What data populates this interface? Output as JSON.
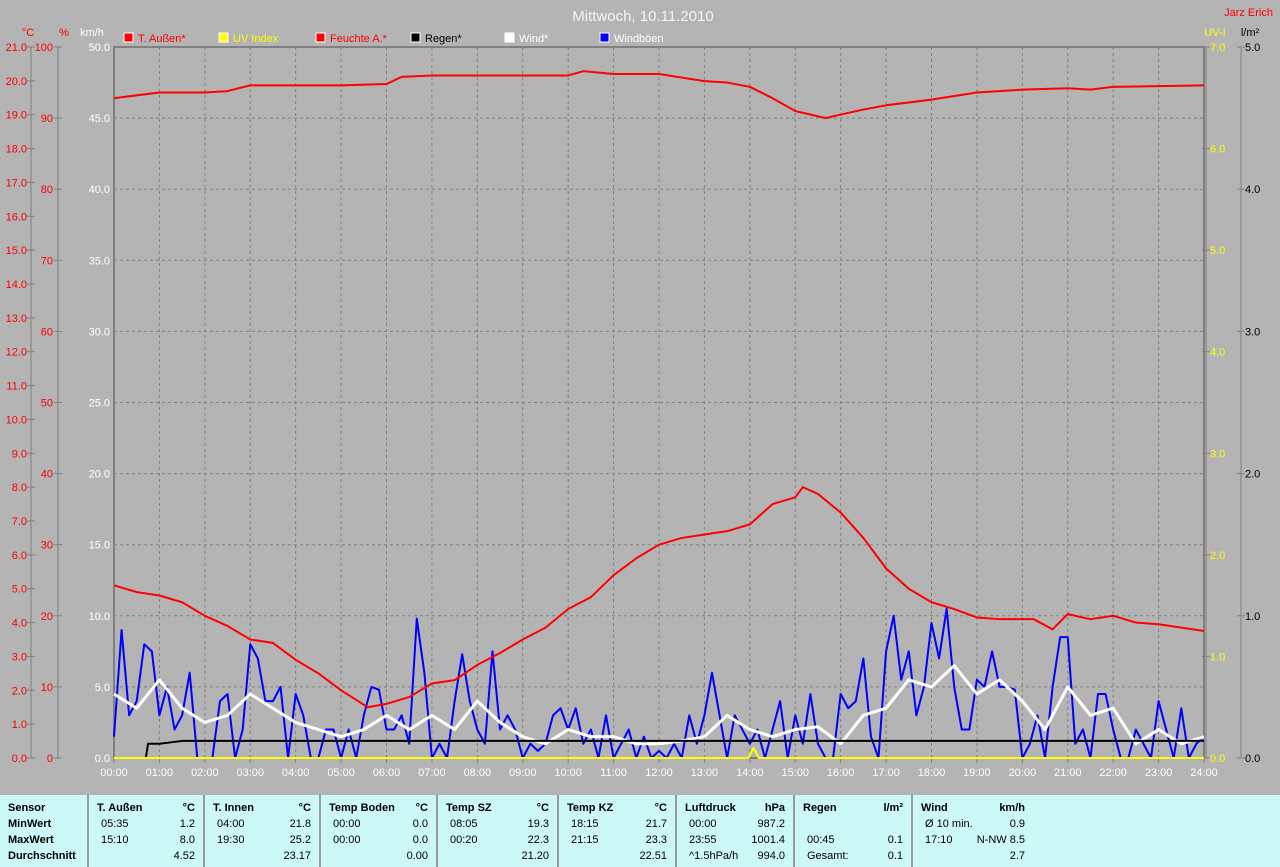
{
  "header": {
    "title": "Mittwoch, 10.11.2010",
    "author": "Jarz Erich"
  },
  "legend": [
    {
      "label": "T. Außen*",
      "color": "#ff0000",
      "text_color": "#ff0000"
    },
    {
      "label": "UV Index",
      "color": "#ffff00",
      "text_color": "#ffff00"
    },
    {
      "label": "Feuchte A.*",
      "color": "#ff0000",
      "text_color": "#ff0000"
    },
    {
      "label": "Regen*",
      "color": "#000000",
      "text_color": "#000000"
    },
    {
      "label": "Wind*",
      "color": "#ffffff",
      "text_color": "#ffffff"
    },
    {
      "label": "Windböen",
      "color": "#0000ff",
      "text_color": "#ffffff"
    }
  ],
  "chart_data": {
    "type": "line",
    "grid": true,
    "x_range": [
      "00:00",
      "24:00"
    ],
    "x_ticks": [
      "00:00",
      "01:00",
      "02:00",
      "03:00",
      "04:00",
      "05:00",
      "06:00",
      "07:00",
      "08:00",
      "09:00",
      "10:00",
      "11:00",
      "12:00",
      "13:00",
      "14:00",
      "15:00",
      "16:00",
      "17:00",
      "18:00",
      "19:00",
      "20:00",
      "21:00",
      "22:00",
      "23:00",
      "24:00"
    ],
    "axes": {
      "temp": {
        "unit": "°C",
        "min": 0,
        "max": 21,
        "step": 1,
        "decimals": 1,
        "color": "#ff0000"
      },
      "humidity": {
        "unit": "%",
        "min": 0,
        "max": 100,
        "step": 10,
        "decimals": 0,
        "color": "#ff0000"
      },
      "wind": {
        "unit": "km/h",
        "min": 0,
        "max": 50,
        "step": 5,
        "decimals": 1,
        "color": "#ffffff"
      },
      "uv": {
        "unit": "UV-I",
        "min": 0,
        "max": 7,
        "step": 1,
        "decimals": 1,
        "color": "#ffff00"
      },
      "rain": {
        "unit": "l/m²",
        "min": 0,
        "max": 5,
        "step": 1,
        "decimals": 1,
        "color": "#000000"
      }
    },
    "series": [
      {
        "name": "T. Außen*",
        "axis": "temp",
        "color": "#ff0000",
        "x": [
          "00:00",
          "00:30",
          "01:00",
          "01:30",
          "02:00",
          "02:30",
          "03:00",
          "03:30",
          "04:00",
          "04:30",
          "05:00",
          "05:35",
          "06:00",
          "06:30",
          "07:00",
          "07:30",
          "08:00",
          "08:30",
          "09:00",
          "09:30",
          "10:00",
          "10:30",
          "11:00",
          "11:30",
          "12:00",
          "12:30",
          "13:00",
          "13:30",
          "14:00",
          "14:30",
          "15:00",
          "15:10",
          "15:30",
          "16:00",
          "16:30",
          "17:00",
          "17:30",
          "18:00",
          "18:30",
          "19:00",
          "19:30",
          "20:00",
          "20:15",
          "20:40",
          "21:00",
          "21:30",
          "22:00",
          "22:30",
          "23:00",
          "23:30",
          "24:00"
        ],
        "y": [
          5.1,
          4.9,
          4.8,
          4.6,
          4.2,
          3.9,
          3.5,
          3.4,
          2.9,
          2.5,
          2.0,
          1.5,
          1.6,
          1.8,
          2.2,
          2.3,
          2.75,
          3.1,
          3.5,
          3.85,
          4.4,
          4.75,
          5.4,
          5.9,
          6.3,
          6.5,
          6.6,
          6.7,
          6.9,
          7.5,
          7.7,
          8.0,
          7.8,
          7.25,
          6.5,
          5.6,
          5.0,
          4.6,
          4.4,
          4.15,
          4.1,
          4.1,
          4.1,
          3.8,
          4.25,
          4.1,
          4.2,
          4.0,
          3.95,
          3.85,
          3.75
        ]
      },
      {
        "name": "Feuchte A.*",
        "axis": "humidity",
        "color": "#ff0000",
        "x": [
          "00:00",
          "01:00",
          "02:00",
          "02:30",
          "03:00",
          "04:00",
          "05:00",
          "06:00",
          "06:20",
          "07:00",
          "08:00",
          "09:00",
          "10:00",
          "10:20",
          "11:00",
          "12:00",
          "13:00",
          "13:30",
          "14:00",
          "14:30",
          "15:00",
          "15:40",
          "16:00",
          "16:30",
          "17:00",
          "18:00",
          "19:00",
          "20:00",
          "21:00",
          "21:30",
          "22:00",
          "23:00",
          "24:00"
        ],
        "y": [
          92.8,
          93.6,
          93.6,
          93.8,
          94.6,
          94.6,
          94.6,
          94.8,
          95.8,
          96.0,
          96.0,
          96.0,
          96.0,
          96.6,
          96.2,
          96.2,
          95.2,
          95.0,
          94.4,
          92.8,
          91.0,
          90.0,
          90.5,
          91.2,
          91.8,
          92.6,
          93.6,
          94.0,
          94.2,
          94.0,
          94.4,
          94.5,
          94.6
        ]
      },
      {
        "name": "UV Index",
        "axis": "uv",
        "color": "#ffff00",
        "x": [
          "00:00",
          "13:58",
          "14:05",
          "14:12",
          "24:00"
        ],
        "y": [
          0,
          0,
          0.1,
          0,
          0
        ]
      },
      {
        "name": "Regen*",
        "axis": "rain",
        "color": "#000000",
        "x": [
          "00:00",
          "00:42",
          "00:45",
          "01:00",
          "01:30",
          "02:00",
          "24:00"
        ],
        "y": [
          0,
          0,
          0.1,
          0.1,
          0.12,
          0.12,
          0.12
        ]
      },
      {
        "name": "Wind*",
        "axis": "wind",
        "color": "#ffffff",
        "start": "00:00",
        "interval_min": 30,
        "y": [
          4.5,
          3.5,
          5.5,
          3.5,
          2.5,
          3,
          4.5,
          3.5,
          2.5,
          2,
          1.5,
          2,
          3,
          2,
          3,
          2,
          4,
          2.5,
          1.5,
          1,
          2,
          1.5,
          1.5,
          1,
          1,
          1.2,
          1.5,
          3,
          2,
          1.5,
          2,
          2.2,
          1,
          3,
          3.5,
          5.5,
          5,
          6.5,
          4.5,
          5.5,
          4,
          2,
          5,
          3,
          3.5,
          1,
          2,
          1,
          1.5
        ]
      },
      {
        "name": "Windböen",
        "axis": "wind",
        "color": "#0000ff",
        "start": "00:00",
        "interval_min": 10,
        "y": [
          1.5,
          9,
          3,
          4,
          8,
          7.5,
          3,
          5,
          2,
          3,
          6,
          0,
          0,
          0,
          4,
          4.5,
          0,
          2,
          8,
          7,
          4,
          4,
          5,
          0,
          4.5,
          3,
          0,
          0,
          2,
          2,
          0,
          2,
          0,
          3,
          5,
          4.8,
          2,
          2,
          3,
          1,
          9.8,
          6,
          0,
          1,
          0,
          4,
          7.3,
          4,
          2,
          1,
          7.5,
          2,
          3,
          2,
          0,
          1,
          0.5,
          1,
          3,
          3.5,
          2,
          3.5,
          1,
          2,
          0,
          3,
          0,
          1,
          2,
          0,
          1.5,
          0,
          0.5,
          0,
          1,
          0,
          3,
          1,
          3,
          6,
          3,
          0,
          3,
          2,
          1,
          2,
          0,
          2,
          4,
          0,
          3,
          1,
          4.5,
          1,
          0,
          0,
          4.5,
          3.5,
          4,
          7,
          1.5,
          0,
          7.5,
          10,
          5.5,
          7.5,
          3,
          5,
          9.5,
          7,
          10.5,
          5,
          2,
          2,
          5.5,
          5,
          7.5,
          5,
          5,
          4.8,
          0,
          1,
          3,
          0,
          5,
          8.5,
          8.5,
          1,
          2,
          0,
          4.5,
          4.5,
          2,
          0,
          0,
          2,
          1,
          0,
          4,
          2,
          0,
          3.5,
          0,
          1,
          1.5
        ]
      }
    ]
  },
  "stats": {
    "columns": [
      {
        "title": "Sensor",
        "unit": "",
        "rows": [
          [
            "MinWert",
            ""
          ],
          [
            "MaxWert",
            ""
          ],
          [
            "Durchschnitt",
            ""
          ]
        ]
      },
      {
        "title": "T. Außen",
        "unit": "°C",
        "rows": [
          [
            "05:35",
            "1.2"
          ],
          [
            "15:10",
            "8.0"
          ],
          [
            "",
            "4.52"
          ]
        ]
      },
      {
        "title": "T. Innen",
        "unit": "°C",
        "rows": [
          [
            "04:00",
            "21.8"
          ],
          [
            "19:30",
            "25.2"
          ],
          [
            "",
            "23.17"
          ]
        ]
      },
      {
        "title": "Temp Boden",
        "unit": "°C",
        "rows": [
          [
            "00:00",
            "0.0"
          ],
          [
            "00:00",
            "0.0"
          ],
          [
            "",
            "0.00"
          ]
        ]
      },
      {
        "title": "Temp SZ",
        "unit": "°C",
        "rows": [
          [
            "08:05",
            "19.3"
          ],
          [
            "00:20",
            "22.3"
          ],
          [
            "",
            "21.20"
          ]
        ]
      },
      {
        "title": "Temp KZ",
        "unit": "°C",
        "rows": [
          [
            "18:15",
            "21.7"
          ],
          [
            "21:15",
            "23.3"
          ],
          [
            "",
            "22.51"
          ]
        ]
      },
      {
        "title": "Luftdruck",
        "unit": "hPa",
        "rows": [
          [
            "00:00",
            "987.2"
          ],
          [
            "23:55",
            "1001.4"
          ],
          [
            "^1.5hPa/h",
            "994.0"
          ]
        ]
      },
      {
        "title": "Regen",
        "unit": "l/m²",
        "rows": [
          [
            "",
            ""
          ],
          [
            "00:45",
            "0.1"
          ],
          [
            "Gesamt:",
            "0.1"
          ]
        ]
      },
      {
        "title": "Wind",
        "unit": "km/h",
        "rows": [
          [
            "Ø 10 min.",
            "0.9"
          ],
          [
            "17:10",
            "N-NW 8.5"
          ],
          [
            "",
            "2.7"
          ]
        ]
      }
    ]
  }
}
